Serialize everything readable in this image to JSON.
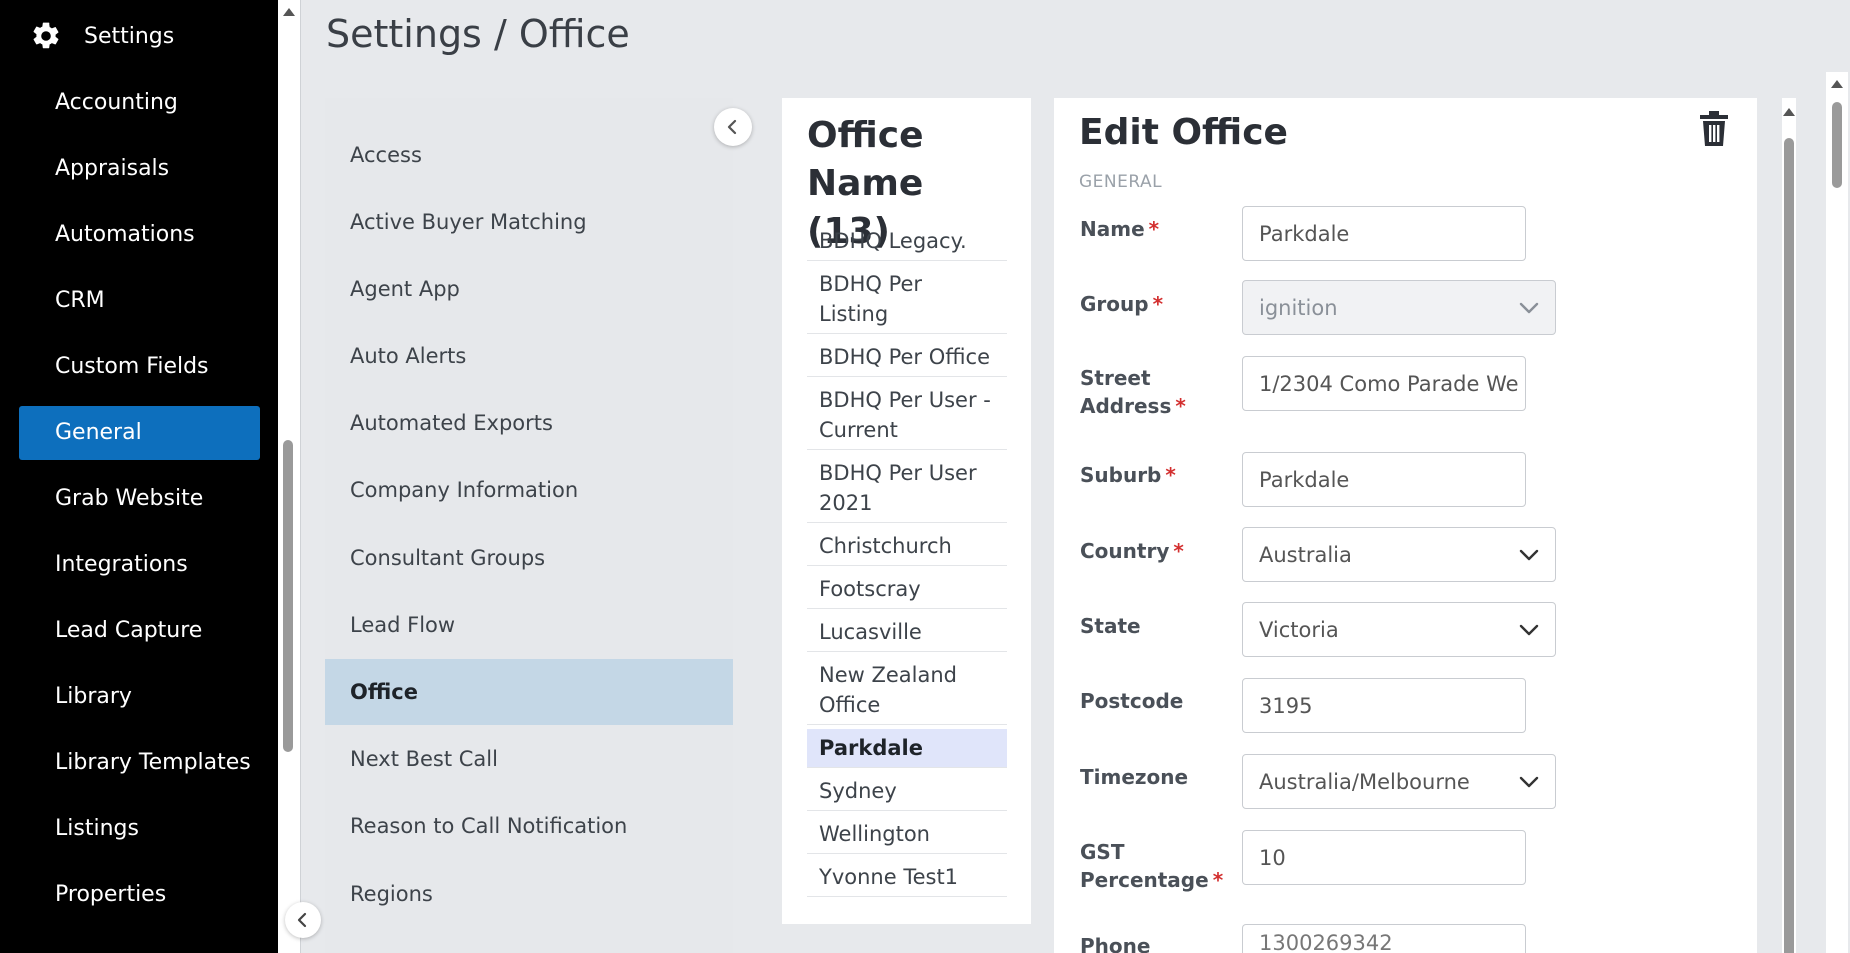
{
  "nav": {
    "title": "Settings",
    "items": [
      {
        "label": "Accounting"
      },
      {
        "label": "Appraisals"
      },
      {
        "label": "Automations"
      },
      {
        "label": "CRM"
      },
      {
        "label": "Custom Fields"
      },
      {
        "label": "General"
      },
      {
        "label": "Grab Website"
      },
      {
        "label": "Integrations"
      },
      {
        "label": "Lead Capture"
      },
      {
        "label": "Library"
      },
      {
        "label": "Library Templates"
      },
      {
        "label": "Listings"
      },
      {
        "label": "Properties"
      }
    ],
    "active_item": "General"
  },
  "header": {
    "title": "Settings / Office"
  },
  "settings_menu": {
    "items": [
      {
        "label": "Access"
      },
      {
        "label": "Active Buyer Matching"
      },
      {
        "label": "Agent App"
      },
      {
        "label": "Auto Alerts"
      },
      {
        "label": "Automated Exports"
      },
      {
        "label": "Company Information"
      },
      {
        "label": "Consultant Groups"
      },
      {
        "label": "Lead Flow"
      },
      {
        "label": "Office"
      },
      {
        "label": "Next Best Call"
      },
      {
        "label": "Reason to Call Notification"
      },
      {
        "label": "Regions"
      }
    ],
    "active_item": "Office"
  },
  "office_list": {
    "title": "Office Name (13)",
    "items": [
      {
        "label": "BDHQ Legacy."
      },
      {
        "label": "BDHQ Per Listing"
      },
      {
        "label": "BDHQ Per Office"
      },
      {
        "label": "BDHQ Per User - Current"
      },
      {
        "label": "BDHQ Per User 2021"
      },
      {
        "label": "Christchurch"
      },
      {
        "label": "Footscray"
      },
      {
        "label": "Lucasville"
      },
      {
        "label": "New Zealand Office"
      },
      {
        "label": "Parkdale"
      },
      {
        "label": "Sydney"
      },
      {
        "label": "Wellington"
      },
      {
        "label": "Yvonne Test1"
      }
    ],
    "active_item": "Parkdale"
  },
  "edit": {
    "title": "Edit Office",
    "section": "GENERAL",
    "fields": {
      "name": {
        "label": "Name",
        "value": "Parkdale",
        "required": "*"
      },
      "group": {
        "label": "Group",
        "value": "ignition",
        "required": "*"
      },
      "street": {
        "label_line1": "Street",
        "label_line2": "Address",
        "value": "1/2304 Como Parade We",
        "required": "*"
      },
      "suburb": {
        "label": "Suburb",
        "value": "Parkdale",
        "required": "*"
      },
      "country": {
        "label": "Country",
        "value": "Australia",
        "required": "*"
      },
      "state": {
        "label": "State",
        "value": "Victoria"
      },
      "postcode": {
        "label": "Postcode",
        "value": "3195"
      },
      "timezone": {
        "label": "Timezone",
        "value": "Australia/Melbourne"
      },
      "gst": {
        "label_line1": "GST",
        "label_line2": "Percentage",
        "value": "10",
        "required": "*"
      },
      "phone": {
        "label": "Phone",
        "value": "1300269342"
      }
    }
  },
  "colors": {
    "nav_bg": "#000000",
    "nav_active": "#0d6fbd",
    "menu_active": "#c4d7e6",
    "list_active": "#e0e5fa",
    "required": "#d32f2f"
  }
}
